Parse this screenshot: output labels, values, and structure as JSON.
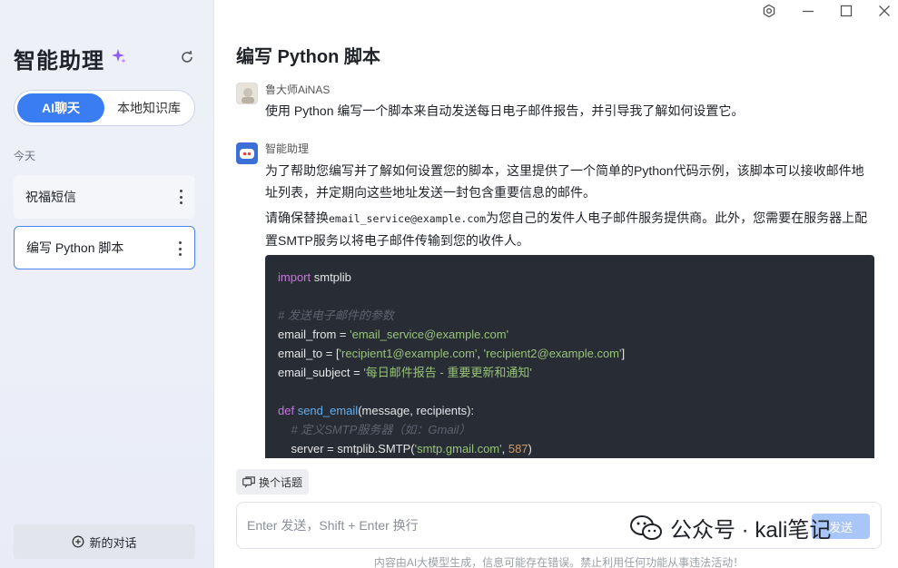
{
  "sidebar": {
    "title": "智能助理",
    "tabs": [
      {
        "label": "AI聊天",
        "active": true
      },
      {
        "label": "本地知识库",
        "active": false
      }
    ],
    "section_label": "今天",
    "conversations": [
      {
        "title": "祝福短信",
        "selected": false
      },
      {
        "title": "编写 Python 脚本",
        "selected": true
      }
    ],
    "new_chat_label": "新的对话"
  },
  "main": {
    "title": "编写 Python 脚本",
    "user": {
      "name": "鲁大师AiNAS",
      "message": "使用 Python 编写一个脚本来自动发送每日电子邮件报告，并引导我了解如何设置它。"
    },
    "assistant": {
      "name": "智能助理",
      "paragraph1": "为了帮助您编写并了解如何设置您的脚本，这里提供了一个简单的Python代码示例，该脚本可以接收邮件地址列表，并定期向这些地址发送一封包含重要信息的邮件。",
      "paragraph2_before": "请确保替换",
      "paragraph2_code": "email_service@example.com",
      "paragraph2_after": "为您自己的发件人电子邮件服务提供商。此外，您需要在服务器上配置SMTP服务以将电子邮件传输到您的收件人。",
      "code": {
        "l1_kw": "import",
        "l1_rest": " smtplib",
        "l3_comment": "# 发送电子邮件的参数",
        "l4_a": "email_from = ",
        "l4_s": "'email_service@example.com'",
        "l5_a": "email_to = [",
        "l5_s1": "'recipient1@example.com'",
        "l5_sep": ", ",
        "l5_s2": "'recipient2@example.com'",
        "l5_end": "]",
        "l6_a": "email_subject = ",
        "l6_s": "'每日邮件报告 - 重要更新和通知'",
        "l8_kw": "def",
        "l8_fn": "send_email",
        "l8_rest": "(message, recipients):",
        "l9_comment": "    # 定义SMTP服务器（如：Gmail）",
        "l10_a": "    server = smtplib.SMTP(",
        "l10_s": "'smtp.gmail.com'",
        "l10_sep": ", ",
        "l10_n": "587",
        "l10_end": ")"
      }
    },
    "switch_topic_label": "换个话题",
    "input_placeholder": "Enter 发送，Shift + Enter 换行",
    "send_label": "发送",
    "disclaimer": "内容由AI大模型生成，信息可能存在错误。禁止利用任何功能从事违法活动！"
  },
  "watermark": {
    "text": "公众号 · kali笔记"
  },
  "colors": {
    "accent": "#3a7cf2",
    "code_bg": "#282c34",
    "send_disabled": "#a8c6f7"
  },
  "icons": [
    "sparkle-icon",
    "refresh-icon",
    "more-icon",
    "add-circle-icon",
    "settings-icon",
    "minimize-icon",
    "maximize-icon",
    "close-icon",
    "switch-topic-icon",
    "wechat-icon"
  ]
}
